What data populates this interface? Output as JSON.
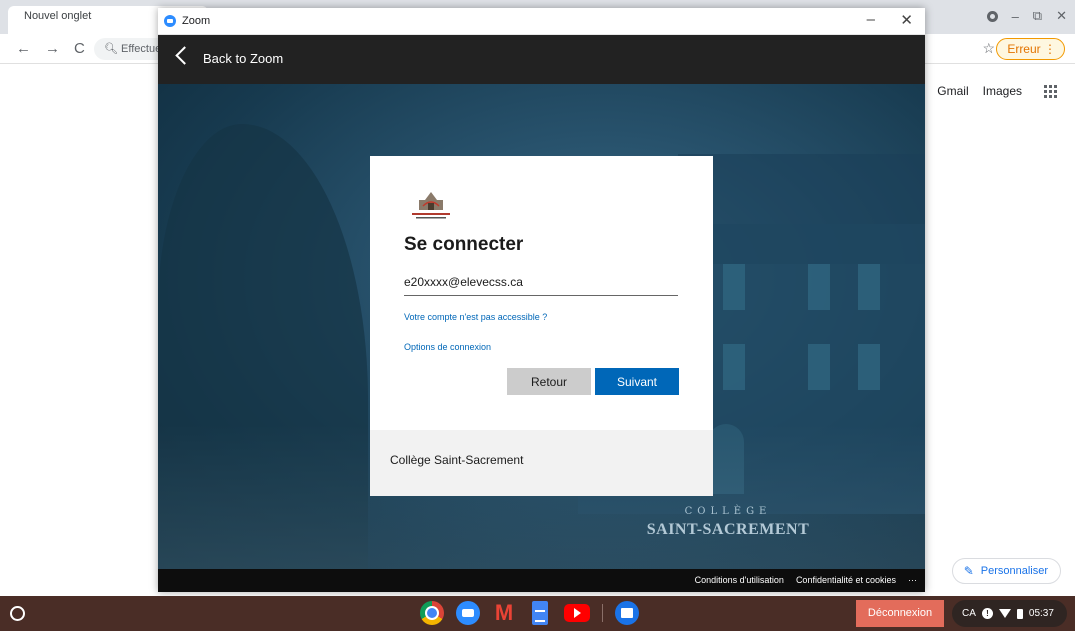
{
  "browser": {
    "tab_title": "Nouvel onglet",
    "omnibox_placeholder": "Effectue",
    "error_button": "Erreur",
    "links": {
      "gmail": "Gmail",
      "images": "Images"
    },
    "customize": "Personnaliser"
  },
  "zoom_window": {
    "title": "Zoom",
    "back_label": "Back to Zoom",
    "footer_terms": "Conditions d'utilisation",
    "footer_privacy": "Confidentialité et cookies",
    "footer_more": "···",
    "watermark_line1": "COLLÈGE",
    "watermark_line2": "SAINT-SACREMENT"
  },
  "signin": {
    "heading": "Se connecter",
    "email_value": "e20xxxx@elevecss.ca",
    "link_inaccessible": "Votre compte n'est pas accessible ?",
    "link_options": "Options de connexion",
    "back_button": "Retour",
    "next_button": "Suivant",
    "org_name": "Collège Saint-Sacrement"
  },
  "shelf": {
    "signout_label": "Déconnexion",
    "tray_lang": "CA",
    "tray_time": "05:37",
    "apps": [
      "chrome-icon",
      "zoom-icon",
      "gmail-icon",
      "docs-icon",
      "youtube-icon",
      "files-icon"
    ]
  },
  "colors": {
    "accent_blue": "#0067b8",
    "signout_red": "#e36c5b",
    "shelf_bg": "#4a2d26",
    "erreur_orange": "#e37400"
  }
}
